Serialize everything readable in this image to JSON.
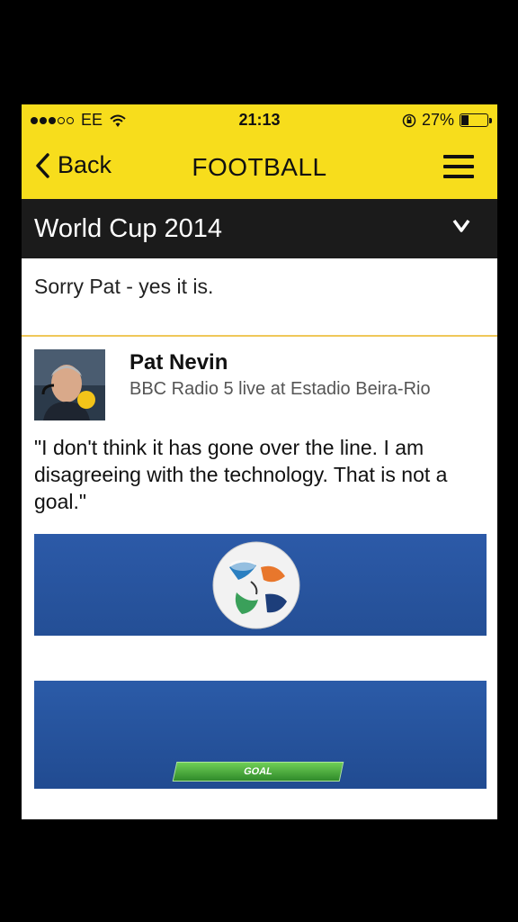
{
  "status_bar": {
    "carrier": "EE",
    "time": "21:13",
    "battery": "27%",
    "battery_level": 0.27,
    "signal_bars_filled": 3,
    "signal_bars_total": 5
  },
  "nav": {
    "back_label": "Back",
    "title": "FOOTBALL"
  },
  "section": {
    "title": "World Cup 2014"
  },
  "post": {
    "message": "Sorry Pat - yes it is.",
    "author_name": "Pat Nevin",
    "author_affiliation": "BBC Radio 5 live at Estadio Beira-Rio",
    "quote": "\"I don't think it has gone over the line. I am disagreeing with the technology. That is not a goal.\"",
    "goal_badge": "GOAL"
  },
  "colors": {
    "brand_yellow": "#f7dd1c",
    "section_bar": "#1b1b1b",
    "pitch_blue": "#2c5aa8",
    "goal_green": "#4caf3f"
  },
  "icons": [
    "wifi-icon",
    "rotation-lock-icon",
    "battery-icon",
    "back-chevron-icon",
    "hamburger-menu-icon",
    "chevron-down-icon"
  ]
}
